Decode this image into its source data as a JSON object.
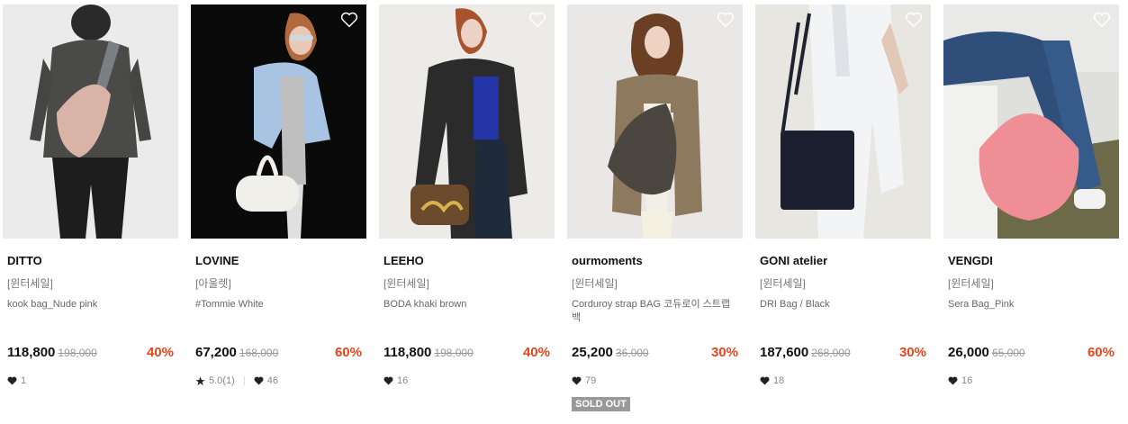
{
  "products": [
    {
      "brand": "DITTO",
      "tag": "[윈터세일]",
      "name": "kook bag_Nude pink",
      "price": "118,800",
      "original_price": "198,000",
      "discount": "40%",
      "likes": "1",
      "bg": "#e9e9e9"
    },
    {
      "brand": "LOVINE",
      "tag": "[아울렛]",
      "name": "#Tommie White",
      "price": "67,200",
      "original_price": "168,000",
      "discount": "60%",
      "rating": "5.0(1)",
      "likes": "46",
      "bg": "#0b0b0b"
    },
    {
      "brand": "LEEHO",
      "tag": "[윈터세일]",
      "name": "BODA khaki brown",
      "price": "118,800",
      "original_price": "198,000",
      "discount": "40%",
      "likes": "16",
      "bg": "#ecebe8"
    },
    {
      "brand": "ourmoments",
      "tag": "[윈터세일]",
      "name": "Corduroy strap BAG 코듀로이 스트랩백",
      "price": "25,200",
      "original_price": "36,000",
      "discount": "30%",
      "likes": "79",
      "sold_out": "SOLD OUT",
      "bg": "#e7e5e2"
    },
    {
      "brand": "GONI atelier",
      "tag": "[윈터세일]",
      "name": "DRI Bag / Black",
      "price": "187,600",
      "original_price": "268,000",
      "discount": "30%",
      "likes": "18",
      "bg": "#e6e4df"
    },
    {
      "brand": "VENGDI",
      "tag": "[윈터세일]",
      "name": "Sera Bag_Pink",
      "price": "26,000",
      "original_price": "65,000",
      "discount": "60%",
      "likes": "16",
      "bg": "#d9d9d6"
    }
  ]
}
